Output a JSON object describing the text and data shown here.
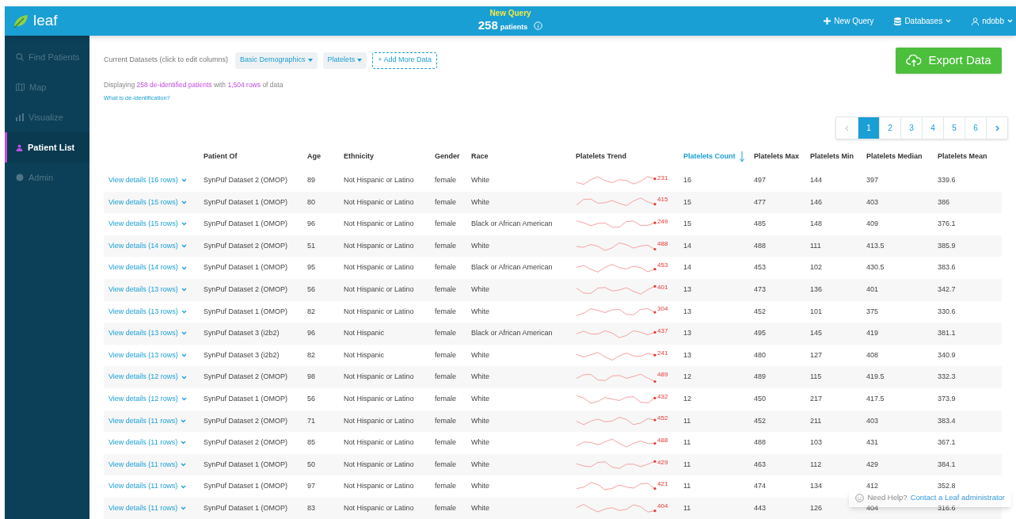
{
  "header": {
    "logo": "leaf",
    "query_title": "New Query",
    "patient_count": "258",
    "patient_unit": "patients",
    "actions": [
      {
        "kind": "new",
        "label": "New Query"
      },
      {
        "kind": "db",
        "label": "Databases"
      },
      {
        "kind": "user",
        "label": "ndobb"
      }
    ]
  },
  "sidebar": {
    "items": [
      {
        "kind": "search",
        "label": "Find Patients",
        "selected": false
      },
      {
        "kind": "map",
        "label": "Map",
        "selected": false
      },
      {
        "kind": "chart",
        "label": "Visualize",
        "selected": false
      },
      {
        "kind": "person",
        "label": "Patient List",
        "selected": true
      },
      {
        "kind": "shield",
        "label": "Admin",
        "selected": false
      }
    ]
  },
  "toolbar": {
    "datasets_label": "Current Datasets (click to edit columns)",
    "datasets": [
      "Basic Demographics",
      "Platelets"
    ],
    "add_button": "+ Add More Data",
    "export_button": "Export Data"
  },
  "summary": {
    "text": "Displaying **258 de-identified patients** with **1,504 rows** of data",
    "link": "What is de-identification?"
  },
  "pagination": {
    "pages": [
      {
        "label": "1",
        "selected": true
      },
      {
        "label": "2",
        "selected": false
      },
      {
        "label": "3",
        "selected": false
      },
      {
        "label": "4",
        "selected": false
      },
      {
        "label": "5",
        "selected": false
      },
      {
        "label": "6",
        "selected": false
      }
    ],
    "prev_disabled": true
  },
  "table": {
    "columns": [
      {
        "label": "Patient Of",
        "sorted": false
      },
      {
        "label": "Age",
        "sorted": false
      },
      {
        "label": "Ethnicity",
        "sorted": false
      },
      {
        "label": "Gender",
        "sorted": false
      },
      {
        "label": "Race",
        "sorted": false
      },
      {
        "label": "Platelets Trend",
        "sorted": false
      },
      {
        "label": "Platelets Count",
        "sorted": true
      },
      {
        "label": "Platelets Max",
        "sorted": false
      },
      {
        "label": "Platelets Min",
        "sorted": false
      },
      {
        "label": "Platelets Median",
        "sorted": false
      },
      {
        "label": "Platelets Mean",
        "sorted": false
      }
    ],
    "rows": [
      {
        "details": "View details (16 rows)",
        "cells": [
          "SynPuf Dataset 2 (OMOP)",
          "89",
          "Not Hispanic or Latino",
          "female",
          "White"
        ],
        "trend_last": "231",
        "stats": [
          "16",
          "497",
          "144",
          "397",
          "339.6"
        ]
      },
      {
        "details": "View details (15 rows)",
        "cells": [
          "SynPuf Dataset 1 (OMOP)",
          "80",
          "Not Hispanic or Latino",
          "female",
          "White"
        ],
        "trend_last": "415",
        "stats": [
          "15",
          "477",
          "146",
          "403",
          "386"
        ]
      },
      {
        "details": "View details (15 rows)",
        "cells": [
          "SynPuf Dataset 1 (OMOP)",
          "96",
          "Not Hispanic or Latino",
          "female",
          "Black or African American"
        ],
        "trend_last": "249",
        "stats": [
          "15",
          "485",
          "148",
          "409",
          "376.1"
        ]
      },
      {
        "details": "View details (14 rows)",
        "cells": [
          "SynPuf Dataset 2 (OMOP)",
          "51",
          "Not Hispanic or Latino",
          "female",
          "White"
        ],
        "trend_last": "488",
        "stats": [
          "14",
          "488",
          "111",
          "413.5",
          "385.9"
        ]
      },
      {
        "details": "View details (14 rows)",
        "cells": [
          "SynPuf Dataset 1 (OMOP)",
          "95",
          "Not Hispanic or Latino",
          "female",
          "Black or African American"
        ],
        "trend_last": "453",
        "stats": [
          "14",
          "453",
          "102",
          "430.5",
          "383.6"
        ]
      },
      {
        "details": "View details (13 rows)",
        "cells": [
          "SynPuf Dataset 2 (OMOP)",
          "56",
          "Not Hispanic or Latino",
          "female",
          "White"
        ],
        "trend_last": "401",
        "stats": [
          "13",
          "473",
          "136",
          "401",
          "342.7"
        ]
      },
      {
        "details": "View details (13 rows)",
        "cells": [
          "SynPuf Dataset 1 (OMOP)",
          "82",
          "Not Hispanic or Latino",
          "female",
          "White"
        ],
        "trend_last": "304",
        "stats": [
          "13",
          "452",
          "101",
          "375",
          "330.6"
        ]
      },
      {
        "details": "View details (13 rows)",
        "cells": [
          "SynPuf Dataset 3 (i2b2)",
          "96",
          "Not Hispanic",
          "female",
          "Black or African American"
        ],
        "trend_last": "437",
        "stats": [
          "13",
          "495",
          "145",
          "419",
          "381.1"
        ]
      },
      {
        "details": "View details (13 rows)",
        "cells": [
          "SynPuf Dataset 3 (i2b2)",
          "82",
          "Not Hispanic",
          "female",
          "White"
        ],
        "trend_last": "241",
        "stats": [
          "13",
          "480",
          "127",
          "408",
          "340.9"
        ]
      },
      {
        "details": "View details (12 rows)",
        "cells": [
          "SynPuf Dataset 2 (OMOP)",
          "98",
          "Not Hispanic or Latino",
          "female",
          "White"
        ],
        "trend_last": "489",
        "stats": [
          "12",
          "489",
          "115",
          "419.5",
          "332.3"
        ]
      },
      {
        "details": "View details (12 rows)",
        "cells": [
          "SynPuf Dataset 1 (OMOP)",
          "56",
          "Not Hispanic or Latino",
          "female",
          "White"
        ],
        "trend_last": "432",
        "stats": [
          "12",
          "450",
          "217",
          "417.5",
          "373.9"
        ]
      },
      {
        "details": "View details (11 rows)",
        "cells": [
          "SynPuf Dataset 2 (OMOP)",
          "71",
          "Not Hispanic or Latino",
          "female",
          "White"
        ],
        "trend_last": "452",
        "stats": [
          "11",
          "452",
          "211",
          "403",
          "383.4"
        ]
      },
      {
        "details": "View details (11 rows)",
        "cells": [
          "SynPuf Dataset 2 (OMOP)",
          "85",
          "Not Hispanic or Latino",
          "female",
          "White"
        ],
        "trend_last": "488",
        "stats": [
          "11",
          "488",
          "103",
          "431",
          "367.1"
        ]
      },
      {
        "details": "View details (11 rows)",
        "cells": [
          "SynPuf Dataset 1 (OMOP)",
          "50",
          "Not Hispanic or Latino",
          "female",
          "White"
        ],
        "trend_last": "429",
        "stats": [
          "11",
          "463",
          "112",
          "429",
          "384.1"
        ]
      },
      {
        "details": "View details (11 rows)",
        "cells": [
          "SynPuf Dataset 1 (OMOP)",
          "97",
          "Not Hispanic or Latino",
          "female",
          "White"
        ],
        "trend_last": "421",
        "stats": [
          "11",
          "474",
          "134",
          "412",
          "352.8"
        ]
      },
      {
        "details": "View details (11 rows)",
        "cells": [
          "SynPuf Dataset 1 (OMOP)",
          "83",
          "Not Hispanic or Latino",
          "female",
          "White"
        ],
        "trend_last": "404",
        "stats": [
          "11",
          "443",
          "126",
          "404",
          "316.6"
        ]
      }
    ]
  },
  "help": {
    "text": "Need Help?",
    "link": "Contact a Leaf administrator"
  }
}
